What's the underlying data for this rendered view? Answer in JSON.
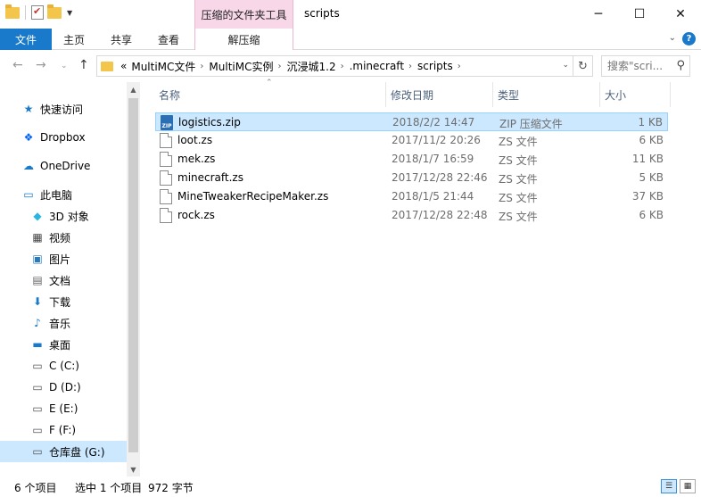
{
  "window": {
    "context_tab_title": "压缩的文件夹工具",
    "title": "scripts",
    "min_glyph": "─",
    "max_glyph": "☐",
    "close_glyph": "✕"
  },
  "ribbon": {
    "tabs": [
      "文件",
      "主页",
      "共享",
      "查看"
    ],
    "context_tab": "解压缩",
    "help": "?"
  },
  "address": {
    "overflow": "«",
    "crumbs": [
      "MultiMC文件",
      "MultiMC实例",
      "沉浸城1.2",
      ".minecraft",
      "scripts"
    ],
    "search_placeholder": "搜索\"scri..."
  },
  "nav": {
    "items": [
      {
        "label": "快速访问",
        "icon": "star-icon",
        "glyph": "★",
        "color": "#1979ca"
      },
      {
        "label": "Dropbox",
        "icon": "dropbox-icon",
        "glyph": "❖",
        "color": "#0061fe"
      },
      {
        "label": "OneDrive",
        "icon": "cloud-icon",
        "glyph": "☁",
        "color": "#1979ca"
      },
      {
        "label": "此电脑",
        "icon": "computer-icon",
        "glyph": "▭",
        "color": "#1979ca"
      },
      {
        "label": "3D 对象",
        "icon": "cube-icon",
        "glyph": "◆",
        "color": "#2bb5e0"
      },
      {
        "label": "视频",
        "icon": "video-icon",
        "glyph": "▦",
        "color": "#444"
      },
      {
        "label": "图片",
        "icon": "picture-icon",
        "glyph": "▣",
        "color": "#2a7ab8"
      },
      {
        "label": "文档",
        "icon": "document-icon",
        "glyph": "▤",
        "color": "#666"
      },
      {
        "label": "下载",
        "icon": "download-icon",
        "glyph": "⬇",
        "color": "#1979ca"
      },
      {
        "label": "音乐",
        "icon": "music-icon",
        "glyph": "♪",
        "color": "#1979ca"
      },
      {
        "label": "桌面",
        "icon": "desktop-icon",
        "glyph": "▬",
        "color": "#1979ca"
      },
      {
        "label": "C (C:)",
        "icon": "drive-icon",
        "glyph": "▭",
        "color": "#555"
      },
      {
        "label": "D (D:)",
        "icon": "drive-icon",
        "glyph": "▭",
        "color": "#555"
      },
      {
        "label": "E (E:)",
        "icon": "drive-icon",
        "glyph": "▭",
        "color": "#555"
      },
      {
        "label": "F (F:)",
        "icon": "drive-icon",
        "glyph": "▭",
        "color": "#555"
      },
      {
        "label": "仓库盘 (G:)",
        "icon": "drive-icon",
        "glyph": "▭",
        "color": "#555",
        "selected": true
      }
    ]
  },
  "columns": {
    "name": "名称",
    "date": "修改日期",
    "type": "类型",
    "size": "大小"
  },
  "files": [
    {
      "name": "logistics.zip",
      "date": "2018/2/2 14:47",
      "type": "ZIP 压缩文件",
      "size": "1 KB",
      "kind": "zip",
      "selected": true
    },
    {
      "name": "loot.zs",
      "date": "2017/11/2 20:26",
      "type": "ZS 文件",
      "size": "6 KB",
      "kind": "doc"
    },
    {
      "name": "mek.zs",
      "date": "2018/1/7 16:59",
      "type": "ZS 文件",
      "size": "11 KB",
      "kind": "doc"
    },
    {
      "name": "minecraft.zs",
      "date": "2017/12/28 22:46",
      "type": "ZS 文件",
      "size": "5 KB",
      "kind": "doc"
    },
    {
      "name": "MineTweakerRecipeMaker.zs",
      "date": "2018/1/5 21:44",
      "type": "ZS 文件",
      "size": "37 KB",
      "kind": "doc"
    },
    {
      "name": "rock.zs",
      "date": "2017/12/28 22:48",
      "type": "ZS 文件",
      "size": "6 KB",
      "kind": "doc"
    }
  ],
  "status": {
    "count": "6 个项目",
    "selection": "选中 1 个项目",
    "size": "972 字节"
  }
}
